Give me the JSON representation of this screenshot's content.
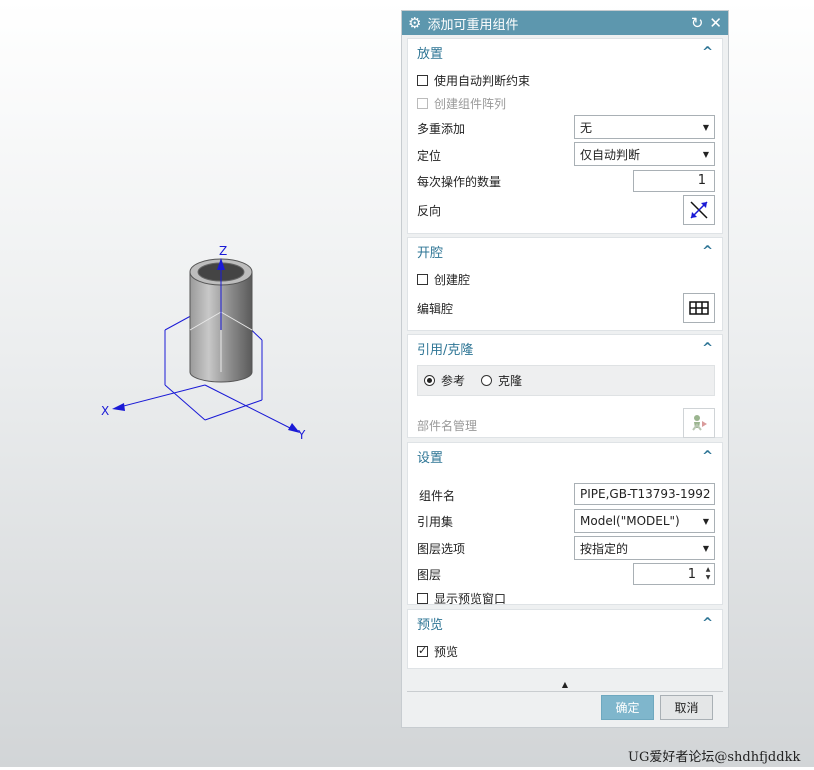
{
  "dialog": {
    "title": "添加可重用组件",
    "ok_label": "确定",
    "cancel_label": "取消"
  },
  "placement": {
    "title": "放置",
    "auto_constraint_label": "使用自动判断约束",
    "create_array_label": "创建组件阵列",
    "multi_add_label": "多重添加",
    "multi_add_value": "无",
    "position_label": "定位",
    "position_value": "仅自动判断",
    "count_label": "每次操作的数量",
    "count_value": "1",
    "reverse_label": "反向"
  },
  "cavity": {
    "title": "开腔",
    "create_cavity_label": "创建腔",
    "edit_cavity_label": "编辑腔"
  },
  "reference": {
    "title": "引用/克隆",
    "reference_label": "参考",
    "clone_label": "克隆",
    "part_name_mgmt_label": "部件名管理"
  },
  "settings": {
    "title": "设置",
    "component_name_label": "组件名",
    "component_name_value": "PIPE,GB-T13793-1992",
    "reference_set_label": "引用集",
    "reference_set_value": "Model(\"MODEL\")",
    "layer_option_label": "图层选项",
    "layer_option_value": "按指定的",
    "layer_label": "图层",
    "layer_value": "1",
    "show_preview_window_label": "显示预览窗口"
  },
  "preview": {
    "title": "预览",
    "preview_label": "预览"
  },
  "viewport": {
    "axis_x": "X",
    "axis_y": "Y",
    "axis_z": "Z"
  },
  "watermark": "UG爱好者论坛@shdhfjddkk",
  "colors": {
    "titlebar": "#5d97ae",
    "section_title": "#2e7595",
    "triad": "#1a1ad6",
    "ok_button": "#7fb6cc"
  }
}
